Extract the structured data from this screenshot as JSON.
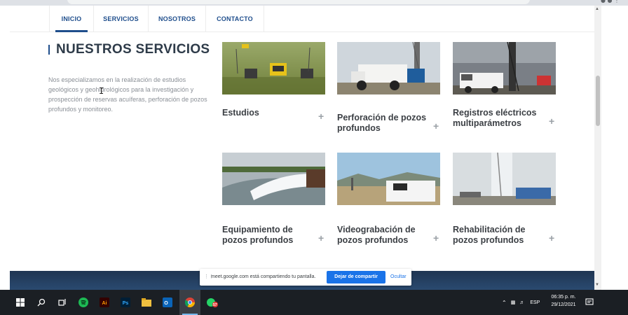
{
  "nav": {
    "tabs": [
      {
        "label": "INICIO"
      },
      {
        "label": "SERVICIOS"
      },
      {
        "label": "NOSOTROS"
      },
      {
        "label": "CONTACTO"
      }
    ]
  },
  "intro": {
    "title": "NUESTROS SERVICIOS",
    "description": "Nos especializamos en la realización de estudios geológicos y geohidrológicos para la investigación y prospección de reservas acuíferas, perforación de pozos profundos y monitoreo."
  },
  "services": [
    {
      "title_line1": "Estudios",
      "title_line2": "",
      "icon": "plus-icon"
    },
    {
      "title_line1": "Perforación de pozos",
      "title_line2": "profundos",
      "icon": "plus-icon"
    },
    {
      "title_line1": "Registros eléctricos",
      "title_line2": "multiparámetros",
      "icon": "plus-icon"
    },
    {
      "title_line1": "Equipamiento de",
      "title_line2": "pozos profundos",
      "icon": "plus-icon"
    },
    {
      "title_line1": "Videograbación de",
      "title_line2": "pozos profundos",
      "icon": "plus-icon"
    },
    {
      "title_line1": "Rehabilitación de",
      "title_line2": "pozos profundos",
      "icon": "plus-icon"
    }
  ],
  "share_bar": {
    "message": "meet.google.com está compartiendo tu pantalla.",
    "stop_label": "Dejar de compartir",
    "hide_label": "Ocultar"
  },
  "taskbar": {
    "language": "ESP",
    "time": "06:35 p. m.",
    "date": "29/12/2021",
    "whatsapp_badge": "57",
    "apps": [
      "windows-start-icon",
      "search-icon",
      "task-view-icon",
      "spotify-icon",
      "illustrator-icon",
      "photoshop-icon",
      "file-explorer-icon",
      "outlook-icon",
      "chrome-icon",
      "whatsapp-icon"
    ]
  },
  "colors": {
    "brand": "#1f4e8c",
    "heading": "#2e3b49",
    "share_button": "#1a73e8",
    "taskbar": "#1b1f24"
  }
}
